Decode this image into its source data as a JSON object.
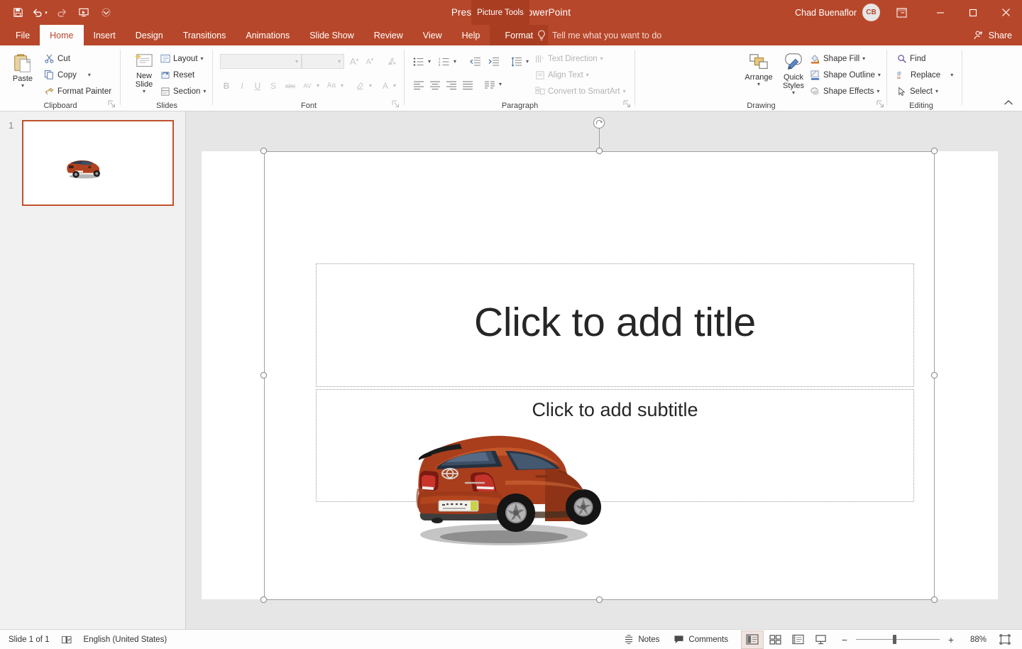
{
  "window": {
    "title": "Presentation1  -  PowerPoint",
    "context_tab_group": "Picture Tools",
    "account_name": "Chad Buenaflor",
    "account_initials": "CB",
    "accent_color": "#b7472a",
    "context_tab_color": "#a93d22"
  },
  "quick_access": [
    {
      "name": "save",
      "icon": "save-icon"
    },
    {
      "name": "undo",
      "icon": "undo-icon"
    },
    {
      "name": "redo",
      "icon": "redo-icon"
    },
    {
      "name": "start-from-beginning",
      "icon": "slideshow-icon"
    },
    {
      "name": "customize-quick-access-toolbar",
      "icon": "chevron-down-icon"
    }
  ],
  "window_controls": {
    "ribbon_display_options": "ribbon-display-options-icon",
    "minimize": "minimize-icon",
    "restore": "restore-icon",
    "close": "close-icon"
  },
  "tabs": [
    {
      "label": "File",
      "active": false
    },
    {
      "label": "Home",
      "active": true
    },
    {
      "label": "Insert",
      "active": false
    },
    {
      "label": "Design",
      "active": false
    },
    {
      "label": "Transitions",
      "active": false
    },
    {
      "label": "Animations",
      "active": false
    },
    {
      "label": "Slide Show",
      "active": false
    },
    {
      "label": "Review",
      "active": false
    },
    {
      "label": "View",
      "active": false
    },
    {
      "label": "Help",
      "active": false
    },
    {
      "label": "Format",
      "active": false,
      "contextual": true
    }
  ],
  "tell_me": {
    "placeholder": "Tell me what you want to do",
    "icon": "lightbulb-icon"
  },
  "share": {
    "label": "Share",
    "icon": "share-person-icon"
  },
  "ribbon": {
    "groups": [
      {
        "name": "Clipboard",
        "label": "Clipboard",
        "has_dialog_launcher": true,
        "buttons": [
          {
            "label": "Paste",
            "type": "big",
            "has_caret": true,
            "icon": "paste-icon"
          },
          {
            "label": "Cut",
            "type": "small",
            "icon": "scissors-icon"
          },
          {
            "label": "Copy",
            "type": "small",
            "icon": "copy-icon",
            "has_caret": true
          },
          {
            "label": "Format Painter",
            "type": "small",
            "icon": "format-painter-icon"
          }
        ]
      },
      {
        "name": "Slides",
        "label": "Slides",
        "has_dialog_launcher": false,
        "buttons": [
          {
            "label": "New Slide",
            "type": "big",
            "has_caret": true,
            "icon": "new-slide-icon"
          },
          {
            "label": "Layout",
            "type": "small",
            "icon": "layout-icon",
            "has_caret": true
          },
          {
            "label": "Reset",
            "type": "small",
            "icon": "reset-icon"
          },
          {
            "label": "Section",
            "type": "small",
            "icon": "section-icon",
            "has_caret": true
          }
        ]
      },
      {
        "name": "Font",
        "label": "Font",
        "has_dialog_launcher": true,
        "disabled": true,
        "font_name_value": "",
        "font_size_value": "",
        "buttons": [
          {
            "label": "Increase Font Size",
            "icon": "increase-font-icon"
          },
          {
            "label": "Decrease Font Size",
            "icon": "decrease-font-icon"
          },
          {
            "label": "Clear All Formatting",
            "icon": "clear-formatting-icon"
          },
          {
            "label": "Bold",
            "icon": "bold-icon",
            "glyph": "B"
          },
          {
            "label": "Italic",
            "icon": "italic-icon",
            "glyph": "I"
          },
          {
            "label": "Underline",
            "icon": "underline-icon",
            "glyph": "U"
          },
          {
            "label": "Text Shadow",
            "icon": "text-shadow-icon",
            "glyph": "S"
          },
          {
            "label": "Strikethrough",
            "icon": "strikethrough-icon",
            "glyph": "abc"
          },
          {
            "label": "Character Spacing",
            "icon": "character-spacing-icon",
            "glyph": "AV"
          },
          {
            "label": "Change Case",
            "icon": "change-case-icon",
            "glyph": "Aa"
          },
          {
            "label": "Text Highlight Color",
            "icon": "highlight-color-icon"
          },
          {
            "label": "Font Color",
            "icon": "font-color-icon",
            "glyph": "A"
          }
        ]
      },
      {
        "name": "Paragraph",
        "label": "Paragraph",
        "has_dialog_launcher": true,
        "buttons": [
          {
            "label": "Bullets",
            "icon": "bullets-icon",
            "has_caret": true
          },
          {
            "label": "Numbering",
            "icon": "numbering-icon",
            "has_caret": true
          },
          {
            "label": "Decrease Indent",
            "icon": "decrease-indent-icon"
          },
          {
            "label": "Increase Indent",
            "icon": "increase-indent-icon"
          },
          {
            "label": "Line Spacing",
            "icon": "line-spacing-icon",
            "has_caret": true
          },
          {
            "label": "Align Left",
            "icon": "align-left-icon"
          },
          {
            "label": "Center",
            "icon": "align-center-icon"
          },
          {
            "label": "Align Right",
            "icon": "align-right-icon"
          },
          {
            "label": "Justify",
            "icon": "justify-icon"
          },
          {
            "label": "Columns",
            "icon": "columns-icon",
            "has_caret": true
          },
          {
            "label": "Text Direction",
            "icon": "text-direction-icon",
            "type": "small",
            "has_caret": true,
            "disabled": true
          },
          {
            "label": "Align Text",
            "icon": "align-text-icon",
            "type": "small",
            "has_caret": true,
            "disabled": true
          },
          {
            "label": "Convert to SmartArt",
            "icon": "smartart-icon",
            "type": "small",
            "has_caret": true,
            "disabled": true
          }
        ]
      },
      {
        "name": "Drawing",
        "label": "Drawing",
        "has_dialog_launcher": true,
        "shapes_gallery": [
          "textbox-shape",
          "line-shape",
          "arrow-shape",
          "rectangle-shape",
          "oval-shape",
          "rounded-rectangle-shape",
          "triangle-shape",
          "elbow-connector-shape",
          "elbow-arrow-connector-shape",
          "right-arrow-shape",
          "down-arrow-shape",
          "pentagon-shape",
          "scribble-shape",
          "arc-shape",
          "curve-shape",
          "left-brace-shape",
          "right-brace-shape",
          "star-shape"
        ],
        "buttons": [
          {
            "label": "Arrange",
            "type": "big",
            "has_caret": true,
            "icon": "arrange-icon"
          },
          {
            "label": "Quick Styles",
            "type": "big",
            "has_caret": true,
            "icon": "quick-styles-icon"
          },
          {
            "label": "Shape Fill",
            "type": "small",
            "icon": "shape-fill-icon",
            "has_caret": true
          },
          {
            "label": "Shape Outline",
            "type": "small",
            "icon": "shape-outline-icon",
            "has_caret": true
          },
          {
            "label": "Shape Effects",
            "type": "small",
            "icon": "shape-effects-icon",
            "has_caret": true
          }
        ]
      },
      {
        "name": "Editing",
        "label": "Editing",
        "has_dialog_launcher": false,
        "buttons": [
          {
            "label": "Find",
            "type": "small",
            "icon": "search-icon"
          },
          {
            "label": "Replace",
            "type": "small",
            "icon": "replace-icon",
            "has_caret": true
          },
          {
            "label": "Select",
            "type": "small",
            "icon": "select-pointer-icon",
            "has_caret": true
          }
        ]
      }
    ],
    "collapse_label": "collapse-ribbon-icon"
  },
  "thumbnails": [
    {
      "number": "1",
      "selected": true,
      "content": "toyota-hatchback-photo"
    }
  ],
  "slide": {
    "title_placeholder": "Click to add title",
    "subtitle_placeholder": "Click to add subtitle",
    "picture": {
      "name": "toyota-hatchback-photo",
      "selected": true,
      "body_color": "#b0431f",
      "description": "red-orange hatchback rear three-quarter view"
    }
  },
  "status_bar": {
    "slide_count": "Slide 1 of 1",
    "language": "English (United States)",
    "spellcheck_icon": "spellcheck-icon",
    "notes": "Notes",
    "comments": "Comments",
    "views": [
      {
        "name": "normal-view",
        "label": "Normal",
        "active": true
      },
      {
        "name": "slide-sorter-view",
        "label": "Slide Sorter",
        "active": false
      },
      {
        "name": "reading-view",
        "label": "Reading View",
        "active": false
      },
      {
        "name": "slide-show-view",
        "label": "Slide Show",
        "active": false
      }
    ],
    "zoom_out": "−",
    "zoom_in": "+",
    "zoom_level": "88%",
    "fit_to_window": "fit-slide-to-window-icon"
  }
}
